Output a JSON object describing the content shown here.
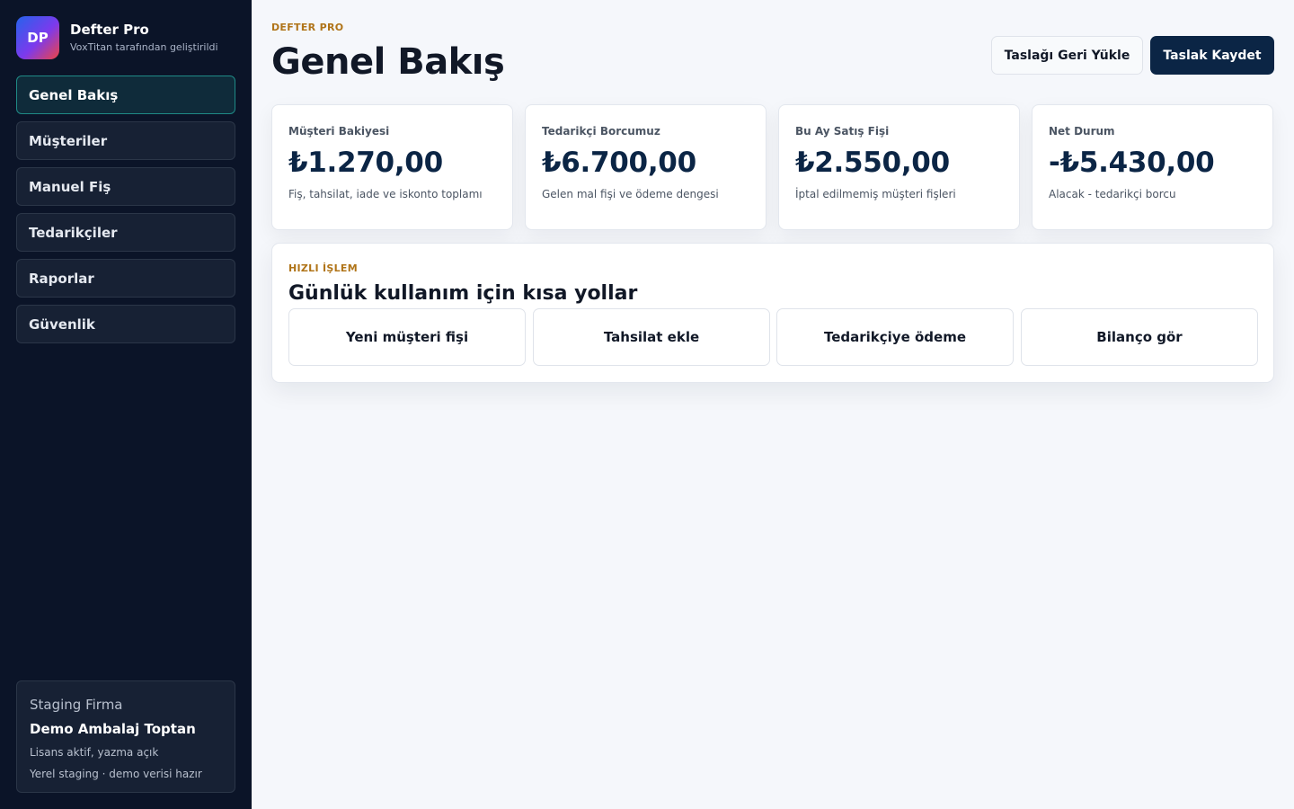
{
  "brand": {
    "logo": "DP",
    "name": "Defter Pro",
    "subtitle": "VoxTitan tarafından geliştirildi"
  },
  "sidebar": {
    "items": [
      {
        "label": "Genel Bakış",
        "active": true
      },
      {
        "label": "Müşteriler"
      },
      {
        "label": "Manuel Fiş"
      },
      {
        "label": "Tedarikçiler"
      },
      {
        "label": "Raporlar"
      },
      {
        "label": "Güvenlik"
      }
    ],
    "firm": {
      "label": "Staging Firma",
      "name": "Demo Ambalaj Toptan",
      "line1": "Lisans aktif, yazma açık",
      "line2": "Yerel staging · demo verisi hazır"
    }
  },
  "header": {
    "eyebrow": "DEFTER PRO",
    "title": "Genel Bakış",
    "restore_label": "Taslağı Geri Yükle",
    "save_label": "Taslak Kaydet"
  },
  "stats": [
    {
      "label": "Müşteri Bakiyesi",
      "value": "₺1.270,00",
      "sub": "Fiş, tahsilat, iade ve iskonto toplamı"
    },
    {
      "label": "Tedarikçi Borcumuz",
      "value": "₺6.700,00",
      "sub": "Gelen mal fişi ve ödeme dengesi"
    },
    {
      "label": "Bu Ay Satış Fişi",
      "value": "₺2.550,00",
      "sub": "İptal edilmemiş müşteri fişleri"
    },
    {
      "label": "Net Durum",
      "value": "-₺5.430,00",
      "sub": "Alacak - tedarikçi borcu"
    }
  ],
  "quick": {
    "eyebrow": "HIZLI İŞLEM",
    "title": "Günlük kullanım için kısa yollar",
    "actions": [
      {
        "label": "Yeni müşteri fişi"
      },
      {
        "label": "Tahsilat ekle"
      },
      {
        "label": "Tedarikçiye ödeme"
      },
      {
        "label": "Bilanço gör"
      }
    ]
  },
  "colors": {
    "sidebar_bg": "#0b1428",
    "accent": "#0b2545",
    "eyebrow": "#b07418",
    "active_border": "#1f8a86"
  }
}
